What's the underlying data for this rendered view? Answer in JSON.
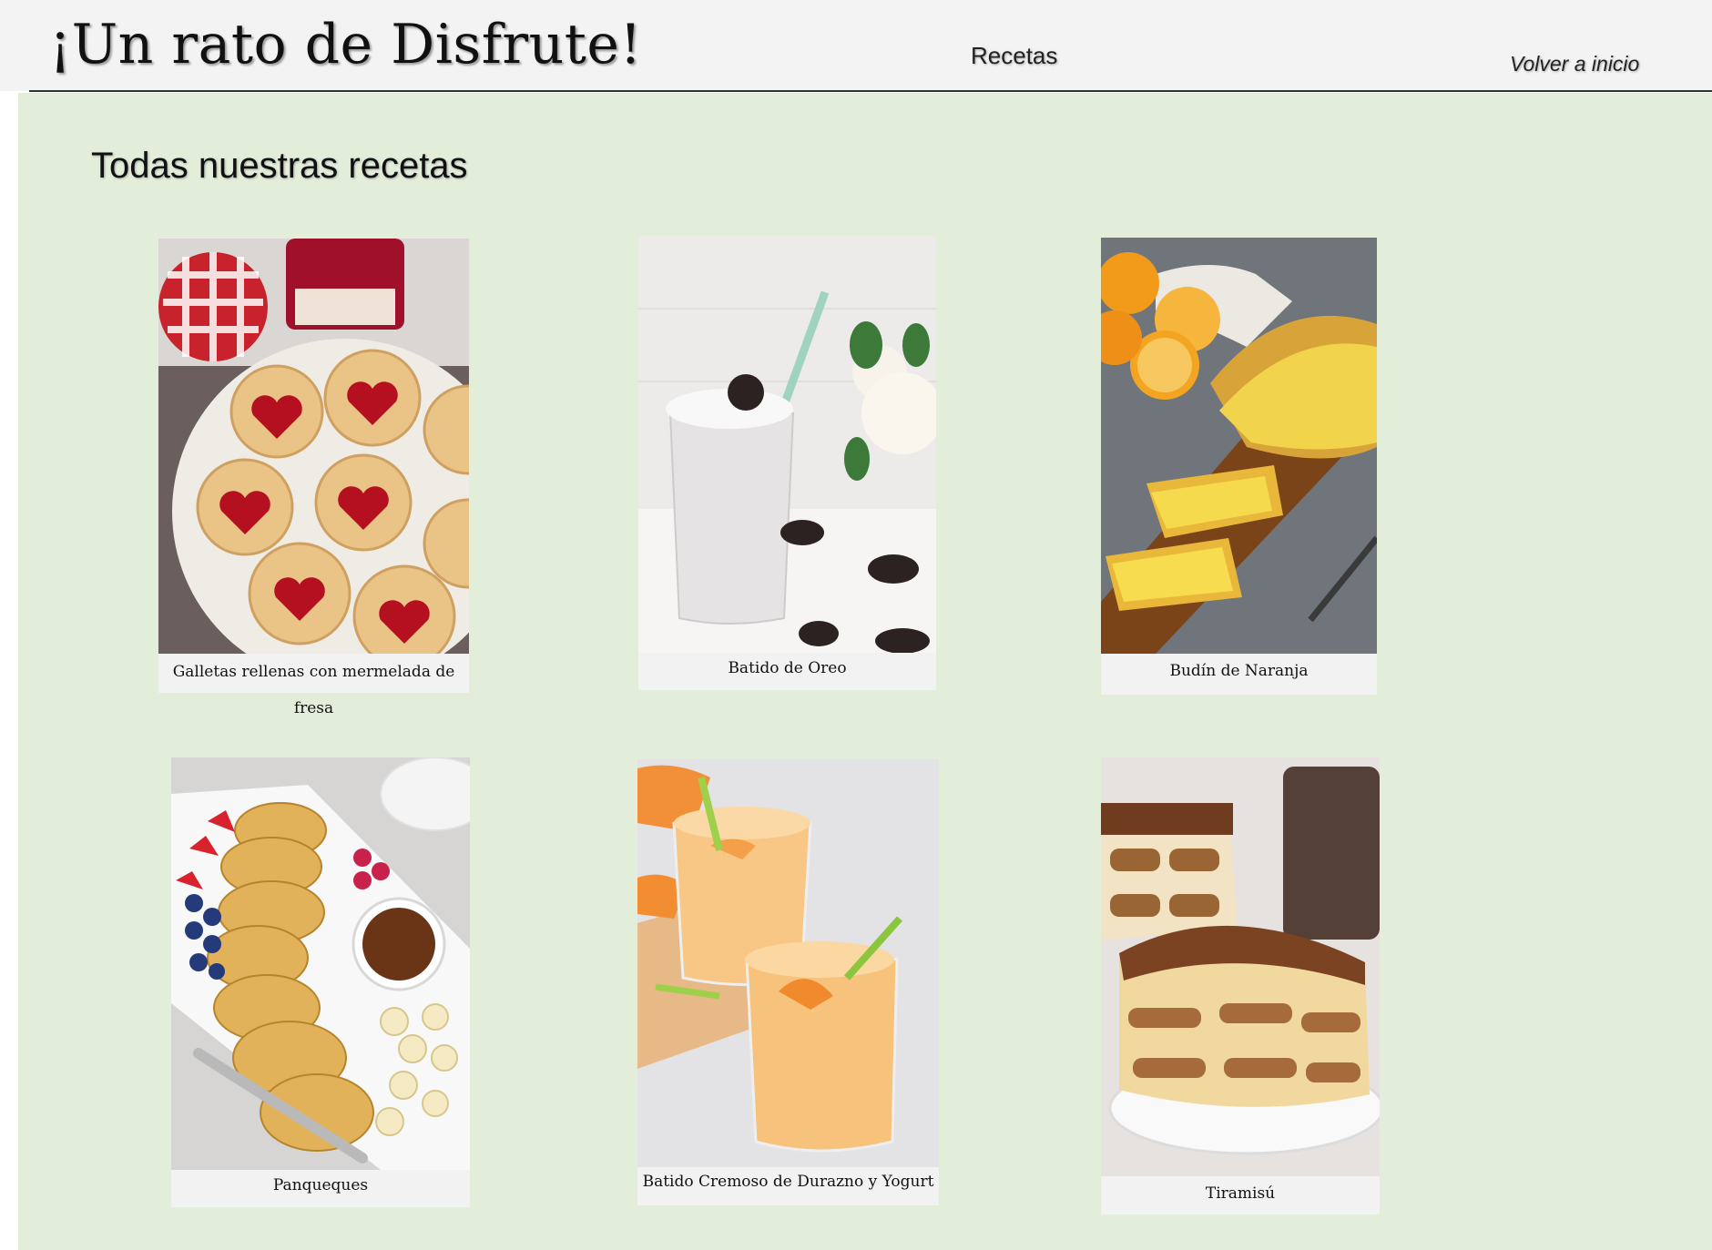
{
  "header": {
    "site_title": "¡Un rato de Disfrute!",
    "nav_recetas": "Recetas",
    "nav_home": "Volver a inicio"
  },
  "main": {
    "section_title": "Todas nuestras recetas"
  },
  "recipes": [
    {
      "name": "Galletas rellenas con mermelada de fresa",
      "image": "heart-jam-cookies-photo"
    },
    {
      "name": "Batido de Oreo",
      "image": "oreo-milkshake-photo"
    },
    {
      "name": "Budín de Naranja",
      "image": "orange-loaf-cake-photo"
    },
    {
      "name": "Panqueques",
      "image": "pancake-platter-photo"
    },
    {
      "name": "Batido Cremoso de Durazno y Yogurt",
      "image": "peach-yogurt-smoothie-photo"
    },
    {
      "name": "Tiramisú",
      "image": "tiramisu-photo"
    }
  ],
  "colors": {
    "header_bg": "#f3f3f3",
    "content_bg": "#e2eed9",
    "caption_bg": "#f2f2f2"
  }
}
